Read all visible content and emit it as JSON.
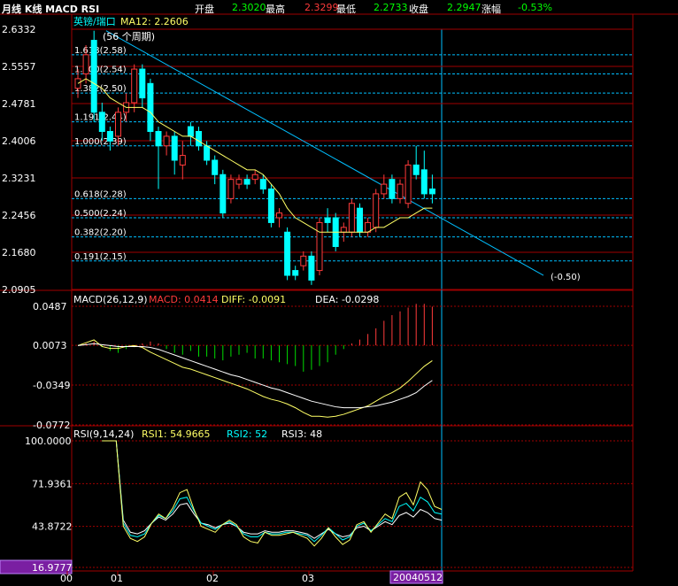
{
  "header": {
    "title": "月线 K线 MACD RSI",
    "open_label": "开盘",
    "open_value": "2.3020",
    "high_label": "最高",
    "high_value": "2.3299",
    "low_label": "最低",
    "low_value": "2.2733",
    "close_label": "收盘",
    "close_value": "2.2947",
    "change_label": "涨幅",
    "change_value": "-0.53%"
  },
  "colors": {
    "up": "#ff3b3b",
    "down": "#00ffff",
    "ma": "#ffff66",
    "frame": "#a00000",
    "grid": "#a00000",
    "trend": "#00bfff",
    "fib": "#00bfff",
    "text": "#ffffff",
    "macd_pos": "#ff3b3b",
    "macd_neg": "#00dd00",
    "diff": "#ffff66",
    "dea": "#ffffff",
    "rsi1": "#ffff66",
    "rsi2": "#00ffff",
    "rsi3": "#ffffff",
    "highlight_bg": "#7a1fa2"
  },
  "chart_data": [
    {
      "type": "candlestick",
      "panel": "price",
      "legend": {
        "symbol": "英镑/瑞口",
        "ma_label": "MA12: 2.2606",
        "period_note": "(56 个周期)",
        "target_note": "(-0.50)"
      },
      "yticks": [
        "2.6332",
        "2.5557",
        "2.4781",
        "2.4006",
        "2.3231",
        "2.2456",
        "2.1680",
        "2.0905"
      ],
      "ylim": [
        2.0905,
        2.6332
      ],
      "fib_levels": [
        {
          "label": "1.618(2.58)",
          "value": 2.58
        },
        {
          "label": "1.500(2.54)",
          "value": 2.54
        },
        {
          "label": "1.382(2.50)",
          "value": 2.5
        },
        {
          "label": "1.191(2.44)",
          "value": 2.44
        },
        {
          "label": "1.000(2.39)",
          "value": 2.39
        },
        {
          "label": "0.618(2.28)",
          "value": 2.28
        },
        {
          "label": "0.500(2.24)",
          "value": 2.24
        },
        {
          "label": "0.382(2.20)",
          "value": 2.2
        },
        {
          "label": "0.191(2.15)",
          "value": 2.15
        }
      ],
      "candles": [
        {
          "o": 2.51,
          "c": 2.53,
          "h": 2.55,
          "l": 2.49
        },
        {
          "o": 2.54,
          "c": 2.58,
          "h": 2.6,
          "l": 2.52
        },
        {
          "o": 2.61,
          "c": 2.46,
          "h": 2.63,
          "l": 2.44
        },
        {
          "o": 2.46,
          "c": 2.42,
          "h": 2.48,
          "l": 2.4
        },
        {
          "o": 2.42,
          "c": 2.4,
          "h": 2.43,
          "l": 2.38
        },
        {
          "o": 2.41,
          "c": 2.46,
          "h": 2.47,
          "l": 2.39
        },
        {
          "o": 2.46,
          "c": 2.48,
          "h": 2.5,
          "l": 2.44
        },
        {
          "o": 2.48,
          "c": 2.55,
          "h": 2.56,
          "l": 2.46
        },
        {
          "o": 2.55,
          "c": 2.49,
          "h": 2.56,
          "l": 2.47
        },
        {
          "o": 2.52,
          "c": 2.42,
          "h": 2.53,
          "l": 2.4
        },
        {
          "o": 2.42,
          "c": 2.39,
          "h": 2.43,
          "l": 2.3
        },
        {
          "o": 2.39,
          "c": 2.41,
          "h": 2.42,
          "l": 2.37
        },
        {
          "o": 2.41,
          "c": 2.36,
          "h": 2.42,
          "l": 2.33
        },
        {
          "o": 2.35,
          "c": 2.37,
          "h": 2.4,
          "l": 2.32
        },
        {
          "o": 2.43,
          "c": 2.41,
          "h": 2.44,
          "l": 2.39
        },
        {
          "o": 2.42,
          "c": 2.39,
          "h": 2.43,
          "l": 2.38
        },
        {
          "o": 2.39,
          "c": 2.36,
          "h": 2.4,
          "l": 2.35
        },
        {
          "o": 2.36,
          "c": 2.33,
          "h": 2.37,
          "l": 2.31
        },
        {
          "o": 2.33,
          "c": 2.25,
          "h": 2.34,
          "l": 2.24
        },
        {
          "o": 2.28,
          "c": 2.32,
          "h": 2.33,
          "l": 2.27
        },
        {
          "o": 2.31,
          "c": 2.32,
          "h": 2.33,
          "l": 2.3
        },
        {
          "o": 2.32,
          "c": 2.31,
          "h": 2.33,
          "l": 2.3
        },
        {
          "o": 2.32,
          "c": 2.33,
          "h": 2.34,
          "l": 2.31
        },
        {
          "o": 2.32,
          "c": 2.3,
          "h": 2.33,
          "l": 2.29
        },
        {
          "o": 2.3,
          "c": 2.23,
          "h": 2.31,
          "l": 2.22
        },
        {
          "o": 2.24,
          "c": 2.25,
          "h": 2.26,
          "l": 2.22
        },
        {
          "o": 2.21,
          "c": 2.12,
          "h": 2.22,
          "l": 2.11
        },
        {
          "o": 2.13,
          "c": 2.12,
          "h": 2.14,
          "l": 2.11
        },
        {
          "o": 2.14,
          "c": 2.16,
          "h": 2.17,
          "l": 2.13
        },
        {
          "o": 2.16,
          "c": 2.11,
          "h": 2.17,
          "l": 2.1
        },
        {
          "o": 2.13,
          "c": 2.23,
          "h": 2.24,
          "l": 2.12
        },
        {
          "o": 2.24,
          "c": 2.23,
          "h": 2.26,
          "l": 2.21
        },
        {
          "o": 2.24,
          "c": 2.18,
          "h": 2.25,
          "l": 2.17
        },
        {
          "o": 2.21,
          "c": 2.22,
          "h": 2.23,
          "l": 2.19
        },
        {
          "o": 2.21,
          "c": 2.27,
          "h": 2.28,
          "l": 2.2
        },
        {
          "o": 2.26,
          "c": 2.21,
          "h": 2.27,
          "l": 2.2
        },
        {
          "o": 2.21,
          "c": 2.23,
          "h": 2.24,
          "l": 2.2
        },
        {
          "o": 2.22,
          "c": 2.29,
          "h": 2.3,
          "l": 2.21
        },
        {
          "o": 2.29,
          "c": 2.31,
          "h": 2.33,
          "l": 2.28
        },
        {
          "o": 2.32,
          "c": 2.28,
          "h": 2.33,
          "l": 2.27
        },
        {
          "o": 2.28,
          "c": 2.31,
          "h": 2.32,
          "l": 2.27
        },
        {
          "o": 2.27,
          "c": 2.35,
          "h": 2.36,
          "l": 2.26
        },
        {
          "o": 2.35,
          "c": 2.33,
          "h": 2.39,
          "l": 2.32
        },
        {
          "o": 2.34,
          "c": 2.29,
          "h": 2.38,
          "l": 2.28
        },
        {
          "o": 2.3,
          "c": 2.29,
          "h": 2.33,
          "l": 2.27
        }
      ],
      "ma12": [
        2.52,
        2.53,
        2.52,
        2.51,
        2.49,
        2.48,
        2.47,
        2.47,
        2.47,
        2.46,
        2.44,
        2.43,
        2.42,
        2.41,
        2.41,
        2.4,
        2.39,
        2.38,
        2.37,
        2.36,
        2.35,
        2.34,
        2.34,
        2.33,
        2.31,
        2.29,
        2.26,
        2.24,
        2.23,
        2.22,
        2.21,
        2.21,
        2.21,
        2.21,
        2.21,
        2.21,
        2.21,
        2.22,
        2.22,
        2.23,
        2.24,
        2.24,
        2.25,
        2.26,
        2.26
      ]
    },
    {
      "type": "bar",
      "panel": "macd",
      "legend": {
        "name": "MACD(26,12,9)",
        "macd_label": "MACD: 0.0414",
        "diff_label": "DIFF: -0.0091",
        "dea_label": "DEA: -0.0298"
      },
      "yticks": [
        "0.0487",
        "0.0073",
        "-0.0349",
        "-0.0772"
      ],
      "ylim": [
        -0.0772,
        0.0487
      ],
      "histogram": [
        0.0,
        0.002,
        0.004,
        -0.002,
        -0.006,
        -0.008,
        -0.004,
        -0.002,
        0.002,
        0.004,
        0.002,
        -0.004,
        -0.008,
        -0.01,
        -0.006,
        -0.012,
        -0.012,
        -0.014,
        -0.016,
        -0.012,
        -0.01,
        -0.008,
        -0.014,
        -0.014,
        -0.016,
        -0.018,
        -0.02,
        -0.022,
        -0.028,
        -0.026,
        -0.022,
        -0.018,
        -0.01,
        -0.004,
        0.002,
        0.006,
        0.012,
        0.018,
        0.026,
        0.032,
        0.036,
        0.04,
        0.044,
        0.044,
        0.041
      ],
      "diff": [
        0.007,
        0.01,
        0.013,
        0.006,
        0.004,
        0.004,
        0.006,
        0.007,
        0.005,
        0.0,
        -0.004,
        -0.008,
        -0.012,
        -0.016,
        -0.018,
        -0.021,
        -0.024,
        -0.027,
        -0.03,
        -0.033,
        -0.036,
        -0.039,
        -0.043,
        -0.047,
        -0.05,
        -0.052,
        -0.055,
        -0.059,
        -0.064,
        -0.068,
        -0.068,
        -0.069,
        -0.068,
        -0.066,
        -0.063,
        -0.06,
        -0.057,
        -0.052,
        -0.047,
        -0.043,
        -0.038,
        -0.031,
        -0.023,
        -0.015,
        -0.009
      ],
      "dea": [
        0.007,
        0.008,
        0.009,
        0.008,
        0.007,
        0.006,
        0.006,
        0.006,
        0.006,
        0.005,
        0.003,
        0.0,
        -0.003,
        -0.006,
        -0.009,
        -0.012,
        -0.015,
        -0.018,
        -0.021,
        -0.024,
        -0.026,
        -0.029,
        -0.032,
        -0.035,
        -0.038,
        -0.04,
        -0.043,
        -0.046,
        -0.049,
        -0.052,
        -0.054,
        -0.056,
        -0.058,
        -0.059,
        -0.059,
        -0.059,
        -0.058,
        -0.057,
        -0.055,
        -0.053,
        -0.05,
        -0.047,
        -0.043,
        -0.036,
        -0.03
      ]
    },
    {
      "type": "line",
      "panel": "rsi",
      "legend": {
        "name": "RSI(9,14,24)",
        "rsi1_label": "RSI1: 54.9665",
        "rsi2_label": "RSI2: 52",
        "rsi3_label": "RSI3: 48"
      },
      "yticks": [
        "100.0000",
        "71.9361",
        "43.8722",
        "16.9777"
      ],
      "ylim": [
        16.9777,
        100.0
      ],
      "x_start": 3,
      "rsi1": [
        100.0,
        100.0,
        100.0,
        44.0,
        36.0,
        34.0,
        37.0,
        46.0,
        52.0,
        49.0,
        56.0,
        66.0,
        68.0,
        55.0,
        44.0,
        42.0,
        40.0,
        45.0,
        48.0,
        45.0,
        37.0,
        34.0,
        33.0,
        40.0,
        38.0,
        38.0,
        39.0,
        40.0,
        38.0,
        36.0,
        31.0,
        36.0,
        43.0,
        37.0,
        32.0,
        35.0,
        45.0,
        47.0,
        40.0,
        46.0,
        52.0,
        49.0,
        63.0,
        66.0,
        58.0,
        73.0,
        68.0,
        57.0,
        55.0
      ],
      "rsi2": [
        100.0,
        100.0,
        100.0,
        46.0,
        38.0,
        37.0,
        39.0,
        46.0,
        51.0,
        49.0,
        54.0,
        62.0,
        63.0,
        54.0,
        46.0,
        44.0,
        42.0,
        45.0,
        47.0,
        44.0,
        39.0,
        37.0,
        37.0,
        40.0,
        39.0,
        39.0,
        40.0,
        40.0,
        39.0,
        38.0,
        34.0,
        38.0,
        43.0,
        39.0,
        35.0,
        37.0,
        44.0,
        46.0,
        41.0,
        45.0,
        49.0,
        47.0,
        57.0,
        59.0,
        54.0,
        63.0,
        60.0,
        53.0,
        52.0
      ],
      "rsi3": [
        100.0,
        100.0,
        100.0,
        48.0,
        40.0,
        39.0,
        41.0,
        46.0,
        50.0,
        48.0,
        52.0,
        58.0,
        59.0,
        52.0,
        46.0,
        45.0,
        43.0,
        45.0,
        46.0,
        44.0,
        40.0,
        39.0,
        39.0,
        41.0,
        40.0,
        40.0,
        41.0,
        41.0,
        40.0,
        39.0,
        36.0,
        39.0,
        42.0,
        39.0,
        37.0,
        38.0,
        43.0,
        44.0,
        41.0,
        44.0,
        47.0,
        45.0,
        51.0,
        53.0,
        50.0,
        55.0,
        53.0,
        49.0,
        48.0
      ]
    }
  ],
  "xaxis": {
    "labels": [
      "00",
      "01",
      "02",
      "03"
    ],
    "highlight": "20040512"
  }
}
